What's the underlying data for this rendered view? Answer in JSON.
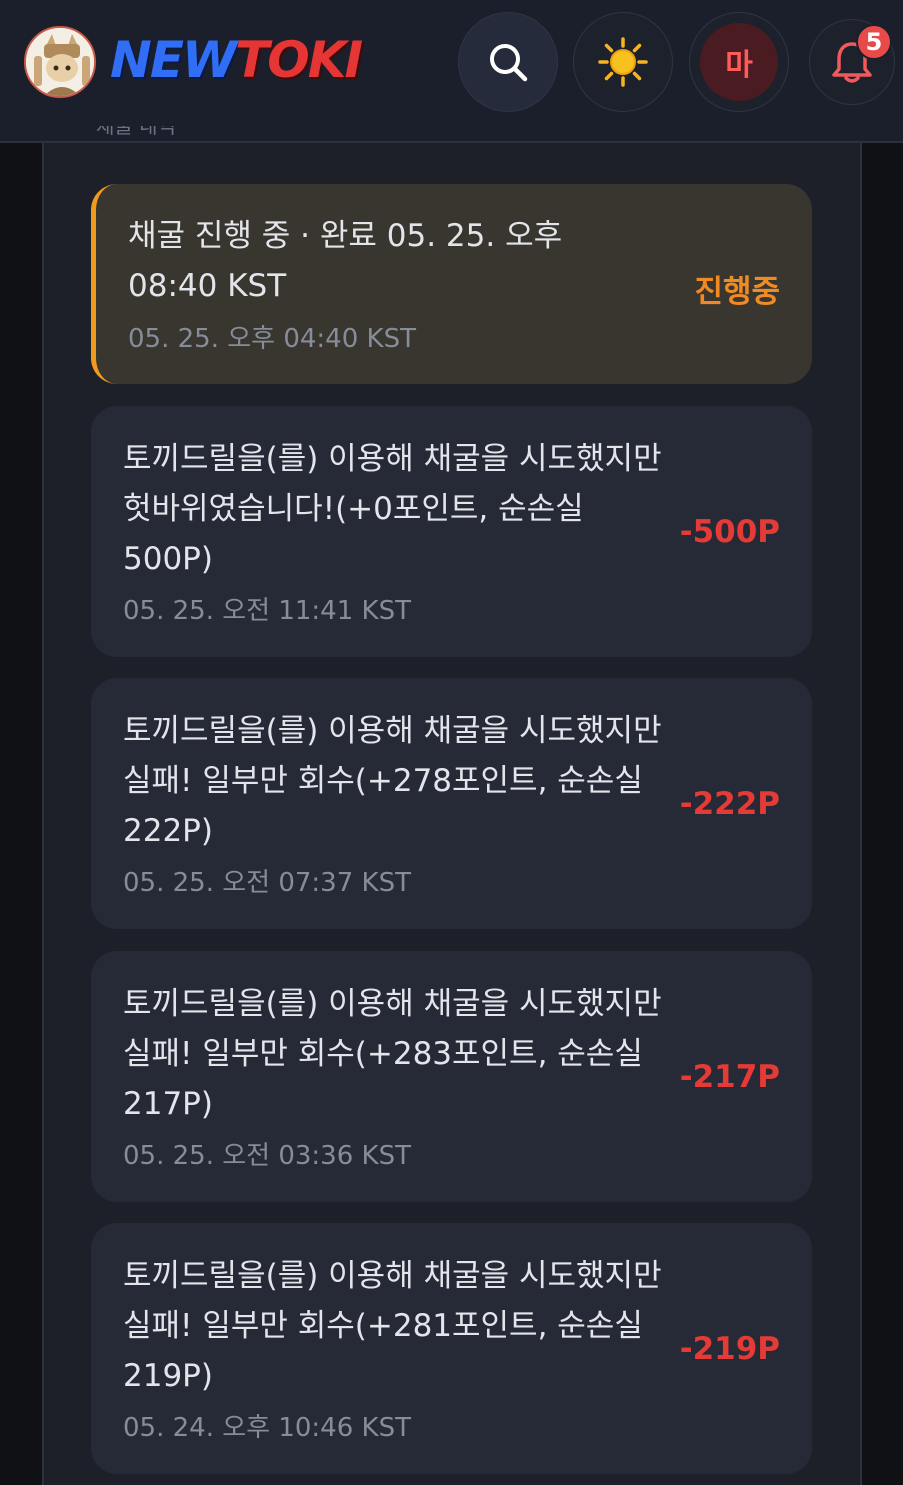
{
  "header": {
    "logo_new": "NEW",
    "logo_toki": "TOKI",
    "user_initial": "마",
    "notification_count": "5"
  },
  "panel": {
    "cut_title": "채굴 내역"
  },
  "entries": [
    {
      "message": "채굴 진행 중 · 완료 05. 25. 오후 08:40 KST",
      "timestamp": "05. 25. 오후 04:40 KST",
      "amount": "진행중",
      "status": "in-progress"
    },
    {
      "message": "토끼드릴을(를) 이용해 채굴을 시도했지만 헛바위였습니다!(+0포인트, 순손실 500P)",
      "timestamp": "05. 25. 오전 11:41 KST",
      "amount": "-500P",
      "status": "loss"
    },
    {
      "message": "토끼드릴을(를) 이용해 채굴을 시도했지만 실패! 일부만 회수(+278포인트, 순손실 222P)",
      "timestamp": "05. 25. 오전 07:37 KST",
      "amount": "-222P",
      "status": "loss"
    },
    {
      "message": "토끼드릴을(를) 이용해 채굴을 시도했지만 실패! 일부만 회수(+283포인트, 순손실 217P)",
      "timestamp": "05. 25. 오전 03:36 KST",
      "amount": "-217P",
      "status": "loss"
    },
    {
      "message": "토끼드릴을(를) 이용해 채굴을 시도했지만 실패! 일부만 회수(+281포인트, 순손실 219P)",
      "timestamp": "05. 24. 오후 10:46 KST",
      "amount": "-219P",
      "status": "loss"
    }
  ],
  "colors": {
    "accent_progress": "#f08a22",
    "loss_red": "#e53a35",
    "logo_blue": "#2f6ef5",
    "logo_red": "#e53535"
  },
  "icons": [
    "search-icon",
    "sun-icon",
    "bell-icon"
  ]
}
